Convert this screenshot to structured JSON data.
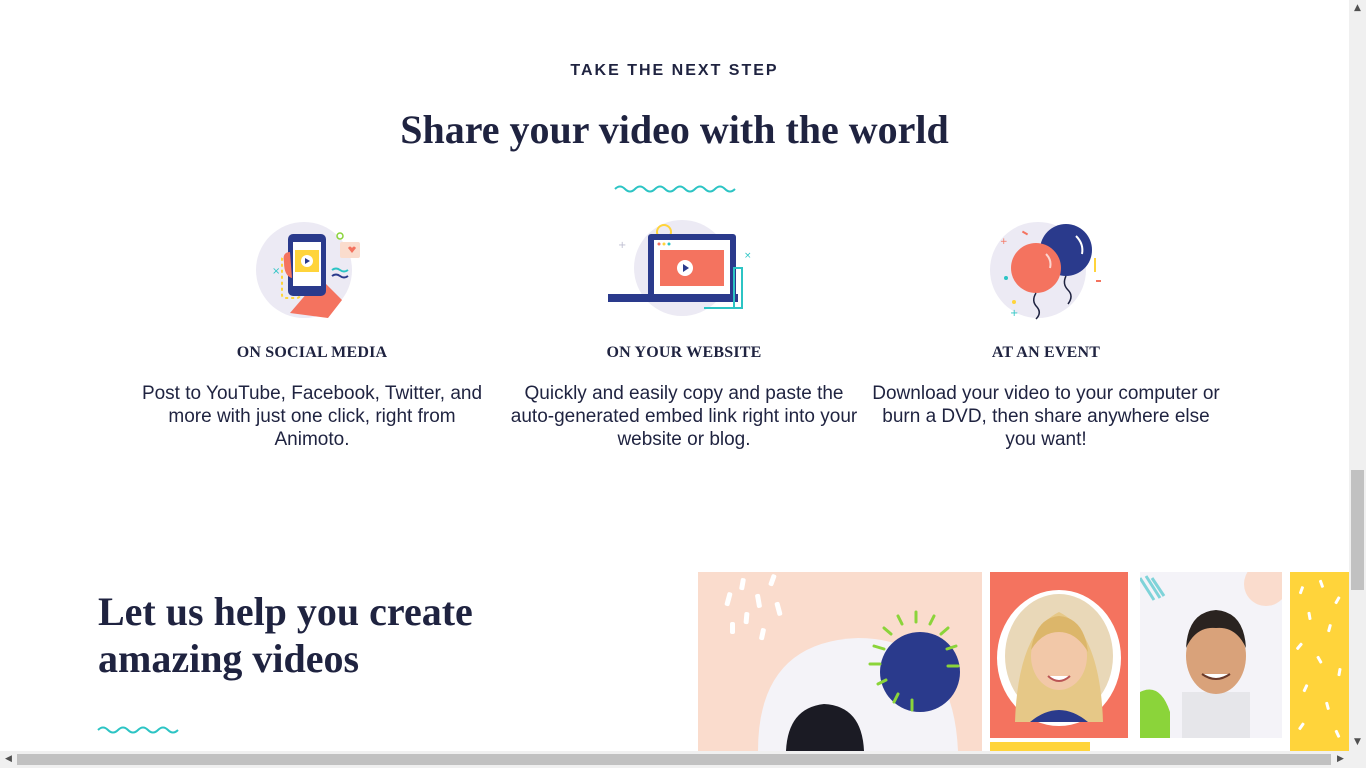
{
  "section": {
    "eyebrow": "TAKE THE NEXT STEP",
    "headline": "Share your video with the world"
  },
  "features": [
    {
      "icon": "phone-in-hand-icon",
      "title": "ON SOCIAL MEDIA",
      "description": "Post to YouTube, Facebook, Twitter, and more with just one click, right from Animoto."
    },
    {
      "icon": "laptop-video-icon",
      "title": "ON YOUR WEBSITE",
      "description": "Quickly and easily copy and paste the auto-generated embed link right into your website or blog."
    },
    {
      "icon": "balloons-icon",
      "title": "AT AN EVENT",
      "description": "Download your video to your computer or burn a DVD, then share anywhere else you want!"
    }
  ],
  "help": {
    "title": "Let us help you create amazing videos"
  },
  "colors": {
    "navy": "#1f2340",
    "teal": "#2cc4c4",
    "coral": "#f4735f",
    "peach": "#fadccd",
    "yellow": "#ffd43b",
    "balloon_blue": "#2a3a8c"
  }
}
